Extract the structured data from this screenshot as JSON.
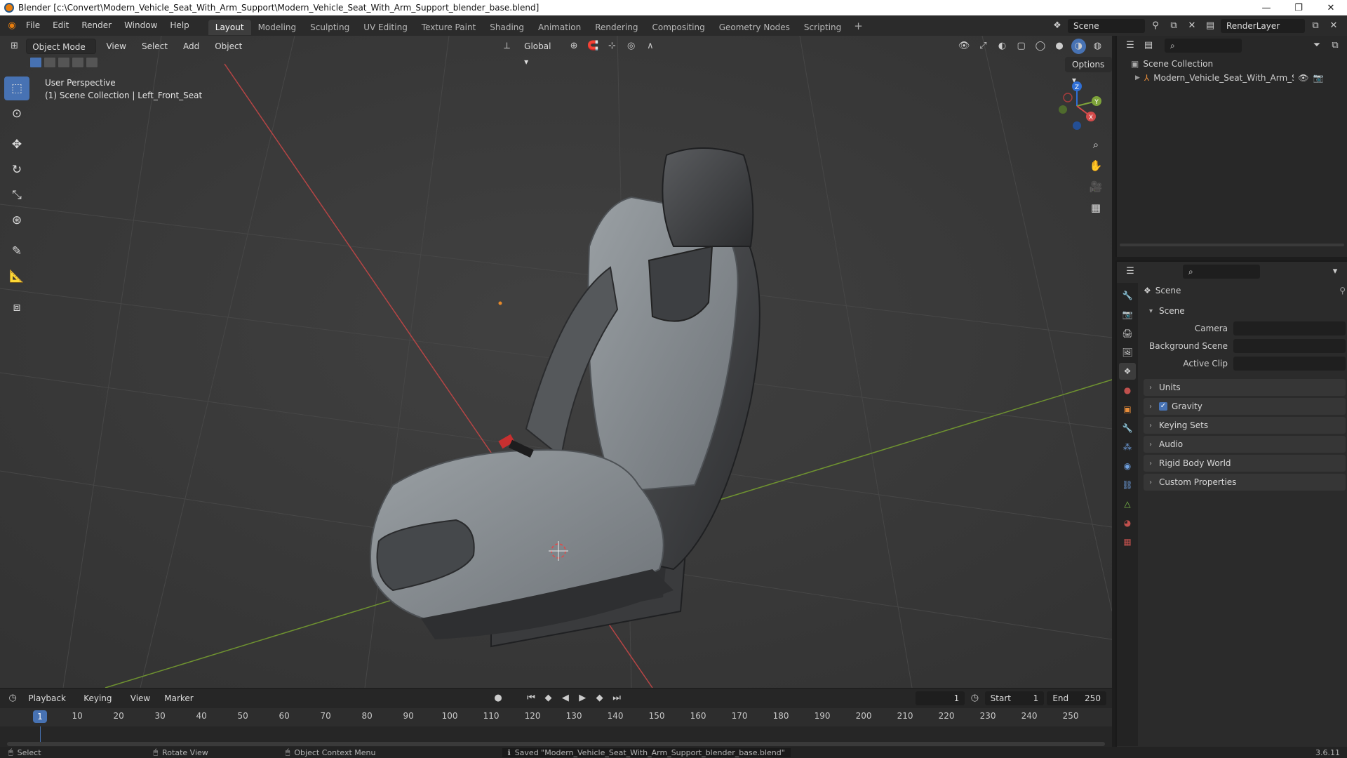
{
  "window": {
    "title": "Blender [c:\\Convert\\Modern_Vehicle_Seat_With_Arm_Support\\Modern_Vehicle_Seat_With_Arm_Support_blender_base.blend]",
    "controls": [
      "—",
      "❐",
      "✕"
    ]
  },
  "menubar": {
    "menus": [
      "File",
      "Edit",
      "Render",
      "Window",
      "Help"
    ],
    "workspaces": [
      "Layout",
      "Modeling",
      "Sculpting",
      "UV Editing",
      "Texture Paint",
      "Shading",
      "Animation",
      "Rendering",
      "Compositing",
      "Geometry Nodes",
      "Scripting"
    ],
    "active_workspace": "Layout",
    "add_tab": "+",
    "scene_name": "Scene",
    "view_layer": "RenderLayer"
  },
  "viewport": {
    "mode": "Object Mode",
    "menus": [
      "View",
      "Select",
      "Add",
      "Object"
    ],
    "orientation": "Global",
    "options_label": "Options",
    "info_line1": "User Perspective",
    "info_line2": "(1) Scene Collection | Left_Front_Seat",
    "gizmo_axes": [
      "X",
      "Y",
      "Z"
    ]
  },
  "timeline": {
    "menus": [
      "Playback",
      "Keying",
      "View",
      "Marker"
    ],
    "current_frame": "1",
    "start_label": "Start",
    "start_value": "1",
    "end_label": "End",
    "end_value": "250",
    "ticks": [
      "10",
      "20",
      "30",
      "40",
      "50",
      "60",
      "70",
      "80",
      "90",
      "100",
      "110",
      "120",
      "130",
      "140",
      "150",
      "160",
      "170",
      "180",
      "190",
      "200",
      "210",
      "220",
      "230",
      "240",
      "250"
    ],
    "playhead": "1"
  },
  "outliner": {
    "root": "Scene Collection",
    "item": "Modern_Vehicle_Seat_With_Arm_Suppoi"
  },
  "properties": {
    "header": "Scene",
    "section": "Scene",
    "rows": [
      {
        "label": "Camera"
      },
      {
        "label": "Background Scene"
      },
      {
        "label": "Active Clip"
      }
    ],
    "panels": [
      "Units",
      "Gravity",
      "Keying Sets",
      "Audio",
      "Rigid Body World",
      "Custom Properties"
    ]
  },
  "statusbar": {
    "select": "Select",
    "rotate": "Rotate View",
    "context": "Object Context Menu",
    "message": "Saved \"Modern_Vehicle_Seat_With_Arm_Support_blender_base.blend\"",
    "version": "3.6.11"
  },
  "colors": {
    "accent": "#4772b3",
    "x_axis": "#d34a4a",
    "y_axis": "#7ea33a",
    "z_axis": "#2f6fd6"
  }
}
